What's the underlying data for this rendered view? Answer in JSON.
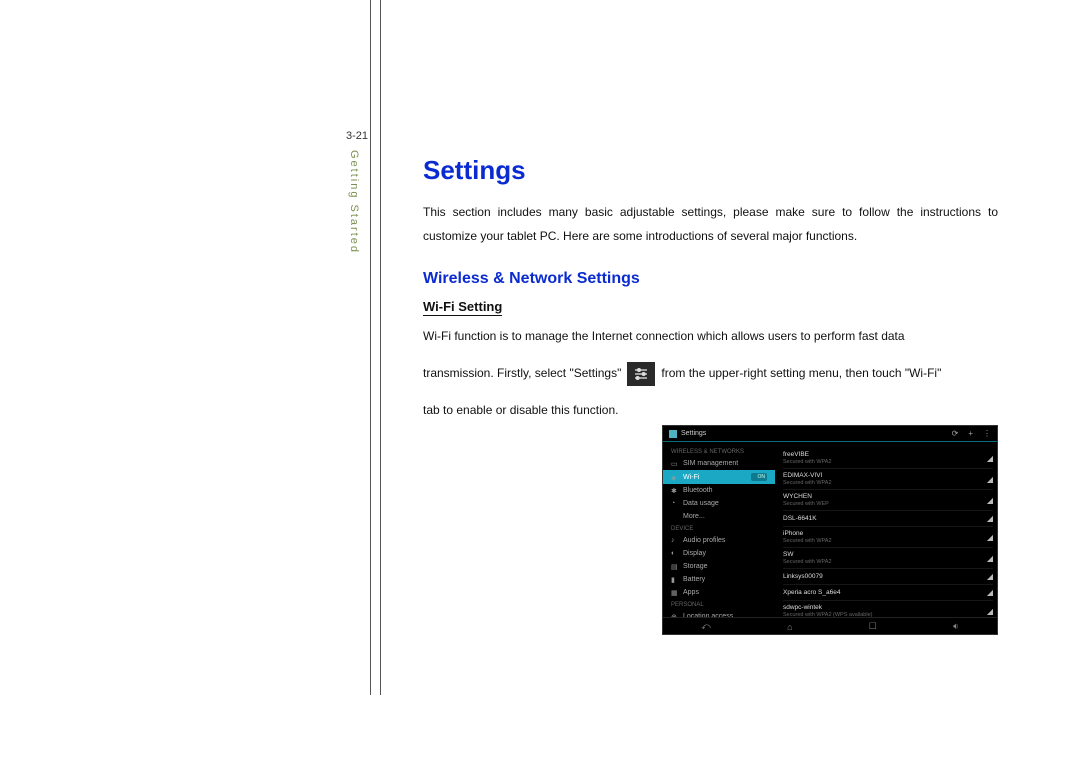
{
  "page_number": "3-21",
  "section_label": "Getting Started",
  "heading1": "Settings",
  "intro": "This section includes many basic adjustable settings, please make sure to follow the instructions to customize your tablet PC. Here are some introductions of several major functions.",
  "heading2": "Wireless & Network Settings",
  "heading3": "Wi-Fi Setting",
  "para_a": "Wi-Fi function is to manage the Internet connection which allows users to perform fast data",
  "para_b_pre": "transmission. Firstly, select \"Settings\"",
  "para_b_post": "from the upper-right setting menu, then touch \"Wi-Fi\"",
  "para_c": "tab to enable or disable this function.",
  "embedded": {
    "title": "Settings",
    "actionbar_icons": [
      "refresh-icon",
      "add-icon",
      "menu-icon"
    ],
    "sidebar": {
      "cat1": "WIRELESS & NETWORKS",
      "items1": [
        {
          "icon": "sim-icon",
          "label": "SIM management"
        },
        {
          "icon": "wifi-icon",
          "label": "Wi-Fi",
          "active": true,
          "toggle": "ON"
        },
        {
          "icon": "bluetooth-icon",
          "label": "Bluetooth"
        },
        {
          "icon": "data-icon",
          "label": "Data usage"
        },
        {
          "icon": "",
          "label": "More..."
        }
      ],
      "cat2": "DEVICE",
      "items2": [
        {
          "icon": "audio-icon",
          "label": "Audio profiles"
        },
        {
          "icon": "display-icon",
          "label": "Display"
        },
        {
          "icon": "storage-icon",
          "label": "Storage"
        },
        {
          "icon": "battery-icon",
          "label": "Battery"
        },
        {
          "icon": "apps-icon",
          "label": "Apps"
        }
      ],
      "cat3": "PERSONAL",
      "items3": [
        {
          "icon": "location-icon",
          "label": "Location access"
        }
      ]
    },
    "networks": [
      {
        "name": "freeVIBE",
        "sub": "Secured with WPA2"
      },
      {
        "name": "EDIMAX-VIVI",
        "sub": "Secured with WPA2"
      },
      {
        "name": "WYCHEN",
        "sub": "Secured with WEP"
      },
      {
        "name": "DSL-6641K",
        "sub": ""
      },
      {
        "name": "iPhone",
        "sub": "Secured with WPA2"
      },
      {
        "name": "SW",
        "sub": "Secured with WPA2"
      },
      {
        "name": "Linksys00079",
        "sub": ""
      },
      {
        "name": "Xperia acro S_a6e4",
        "sub": ""
      },
      {
        "name": "sdwpc-wintek",
        "sub": "Secured with WPA2 (WPS available)"
      }
    ],
    "navbar": [
      "back-icon",
      "home-icon",
      "recent-icon",
      "volume-icon"
    ]
  }
}
